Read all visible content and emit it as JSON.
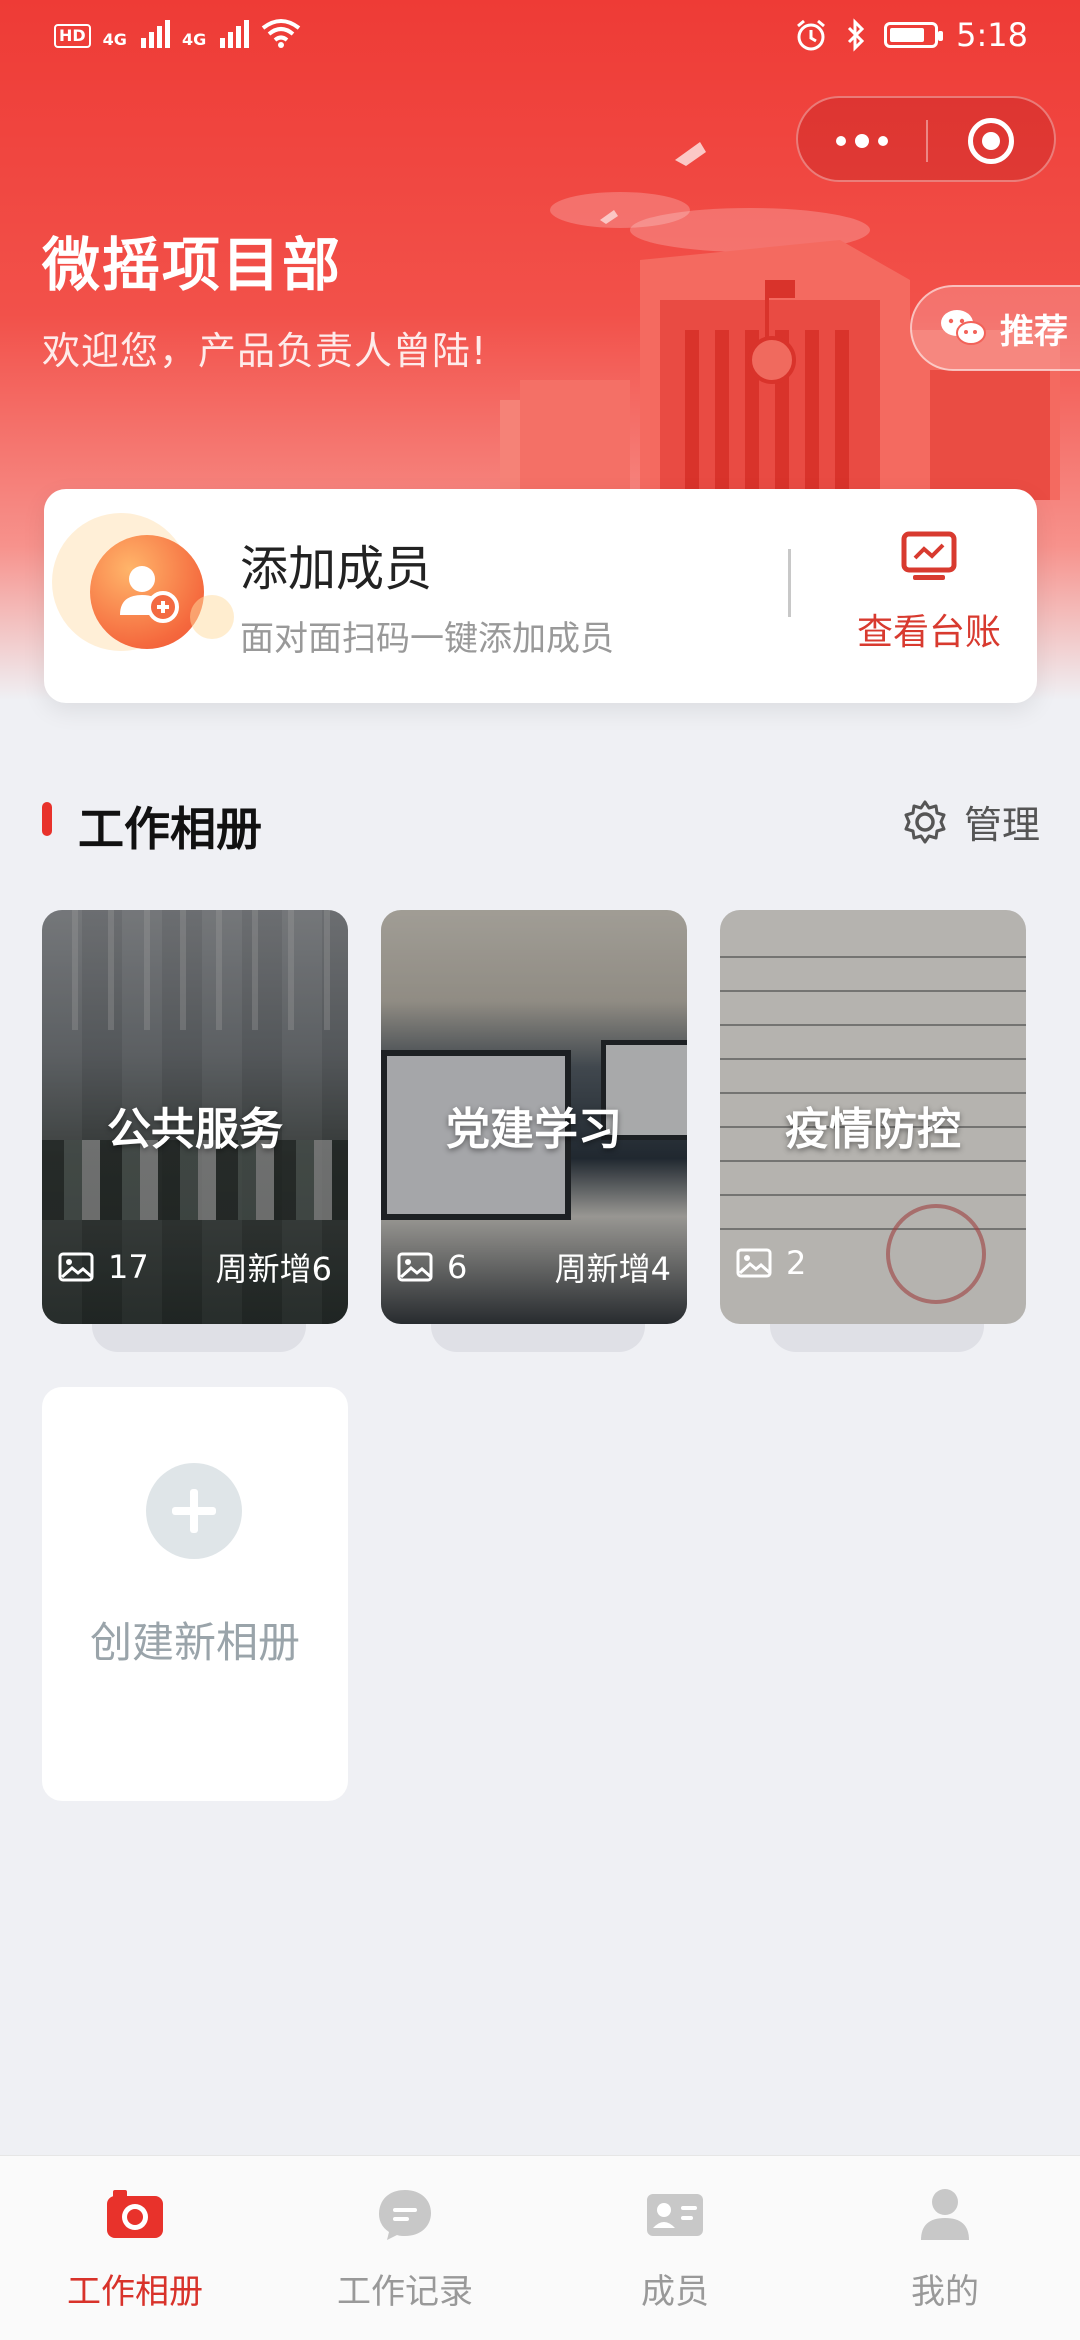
{
  "status_bar": {
    "time": "5:18",
    "hd": "HD",
    "net1": "4G",
    "net2": "4G"
  },
  "header": {
    "title": "微摇项目部",
    "welcome": "欢迎您，产品负责人曾陆!",
    "recommend_label": "推荐"
  },
  "member_card": {
    "title": "添加成员",
    "subtitle": "面对面扫码一键添加成员",
    "ledger_label": "查看台账"
  },
  "section": {
    "title": "工作相册",
    "manage_label": "管理"
  },
  "albums": [
    {
      "name": "公共服务",
      "count": "17",
      "weekly": "周新增6"
    },
    {
      "name": "党建学习",
      "count": "6",
      "weekly": "周新增4"
    },
    {
      "name": "疫情防控",
      "count": "2",
      "weekly": ""
    }
  ],
  "create_album": {
    "label": "创建新相册"
  },
  "tabbar": {
    "items": [
      {
        "label": "工作相册",
        "icon": "camera-icon",
        "active": true
      },
      {
        "label": "工作记录",
        "icon": "chat-bubble-icon",
        "active": false
      },
      {
        "label": "成员",
        "icon": "id-card-icon",
        "active": false
      },
      {
        "label": "我的",
        "icon": "person-icon",
        "active": false
      }
    ]
  },
  "colors": {
    "brand": "#e8322b",
    "accent_text": "#d83a2f",
    "background": "#eff0f4"
  }
}
